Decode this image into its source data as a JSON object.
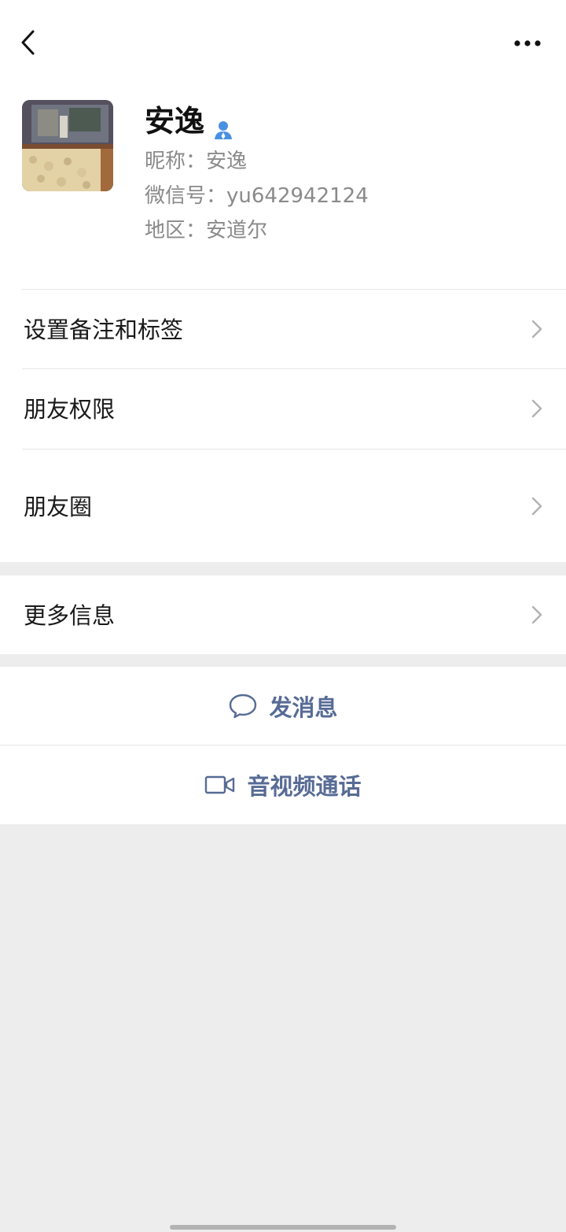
{
  "nav": {
    "back_icon": "chevron-left-icon",
    "more_icon": "more-dots-icon"
  },
  "profile": {
    "name": "安逸",
    "badge_icon": "contact-person-icon",
    "nickname": "昵称：安逸",
    "wechat_id": "微信号：yu642942124",
    "region": "地区：安道尔"
  },
  "menu": {
    "remarks_label": "设置备注和标签",
    "permissions_label": "朋友权限",
    "moments_label": "朋友圈",
    "more_info_label": "更多信息"
  },
  "actions": {
    "message_label": "发消息",
    "message_icon": "chat-bubble-icon",
    "call_label": "音视频通话",
    "call_icon": "video-camera-icon"
  },
  "colors": {
    "accent": "#576b95",
    "badge": "#4a90e2",
    "background": "#ededed"
  }
}
